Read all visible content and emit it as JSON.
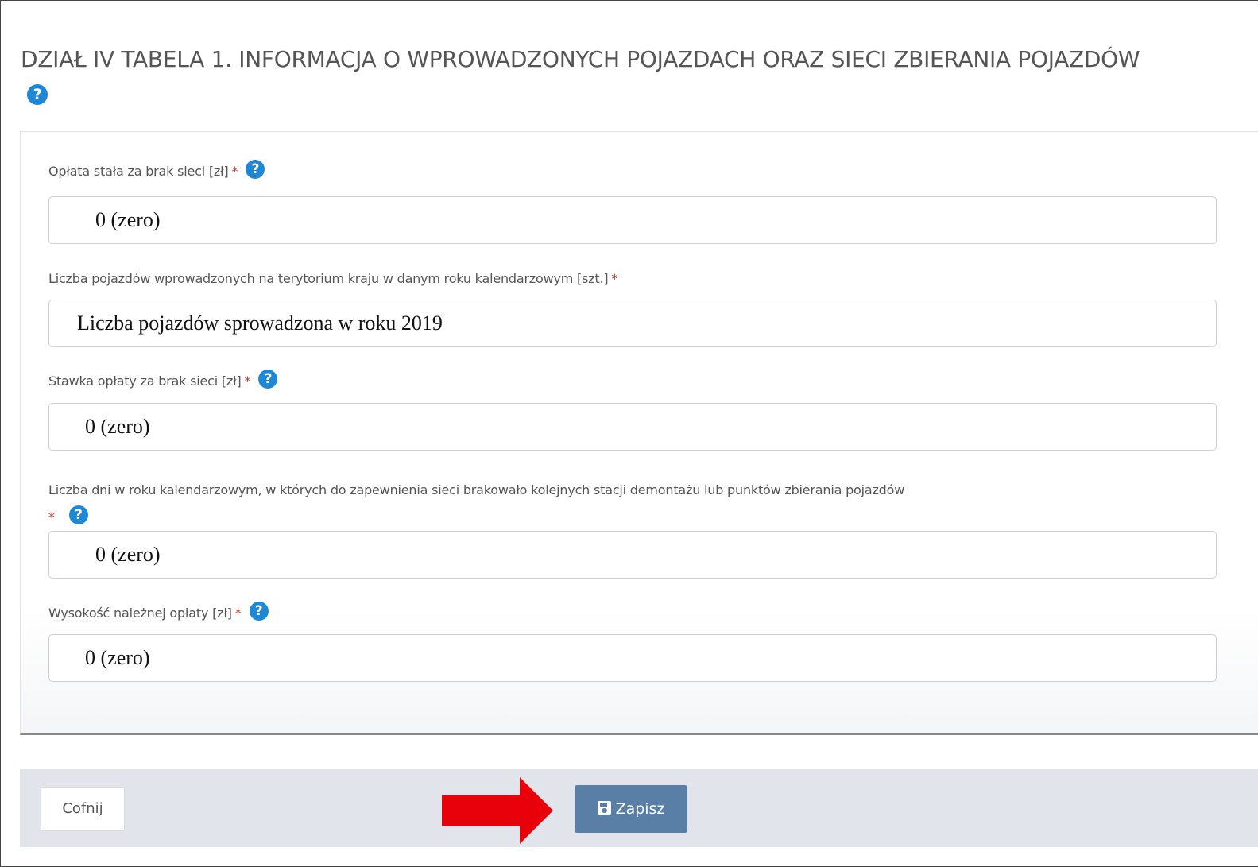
{
  "title": {
    "text": "DZIAŁ IV TABELA 1. INFORMACJA O WPROWADZONYCH POJAZDACH ORAZ SIECI ZBIERANIA POJAZDÓW",
    "help_icon": "question-circle"
  },
  "fields": [
    {
      "label": "Opłata stała za brak sieci [zł]",
      "required_mark": "*",
      "has_help": true,
      "value": "0 (zero)"
    },
    {
      "label": "Liczba pojazdów wprowadzonych na terytorium kraju w danym roku kalendarzowym [szt.]",
      "required_mark": "*",
      "has_help": false,
      "value": "Liczba pojazdów sprowadzona w roku 2019"
    },
    {
      "label": "Stawka opłaty za brak sieci [zł]",
      "required_mark": "*",
      "has_help": true,
      "value": "0 (zero)"
    },
    {
      "label": "Liczba dni w roku kalendarzowym, w których do zapewnienia sieci brakowało kolejnych stacji demontażu lub punktów zbierania pojazdów",
      "required_mark": "*",
      "has_help": true,
      "value": "0 (zero)"
    },
    {
      "label": "Wysokość należnej opłaty [zł]",
      "required_mark": "*",
      "has_help": true,
      "value": "0 (zero)"
    }
  ],
  "footer": {
    "back_label": "Cofnij",
    "save_label": "Zapisz",
    "save_icon": "floppy-disk"
  },
  "annotation": {
    "arrow_color": "#e8000b",
    "arrow_direction": "right"
  },
  "colors": {
    "help_icon": "#1e88d6",
    "required": "#c0392b",
    "save_button": "#5a7fa7",
    "footer_bg": "#e1e5eb"
  }
}
